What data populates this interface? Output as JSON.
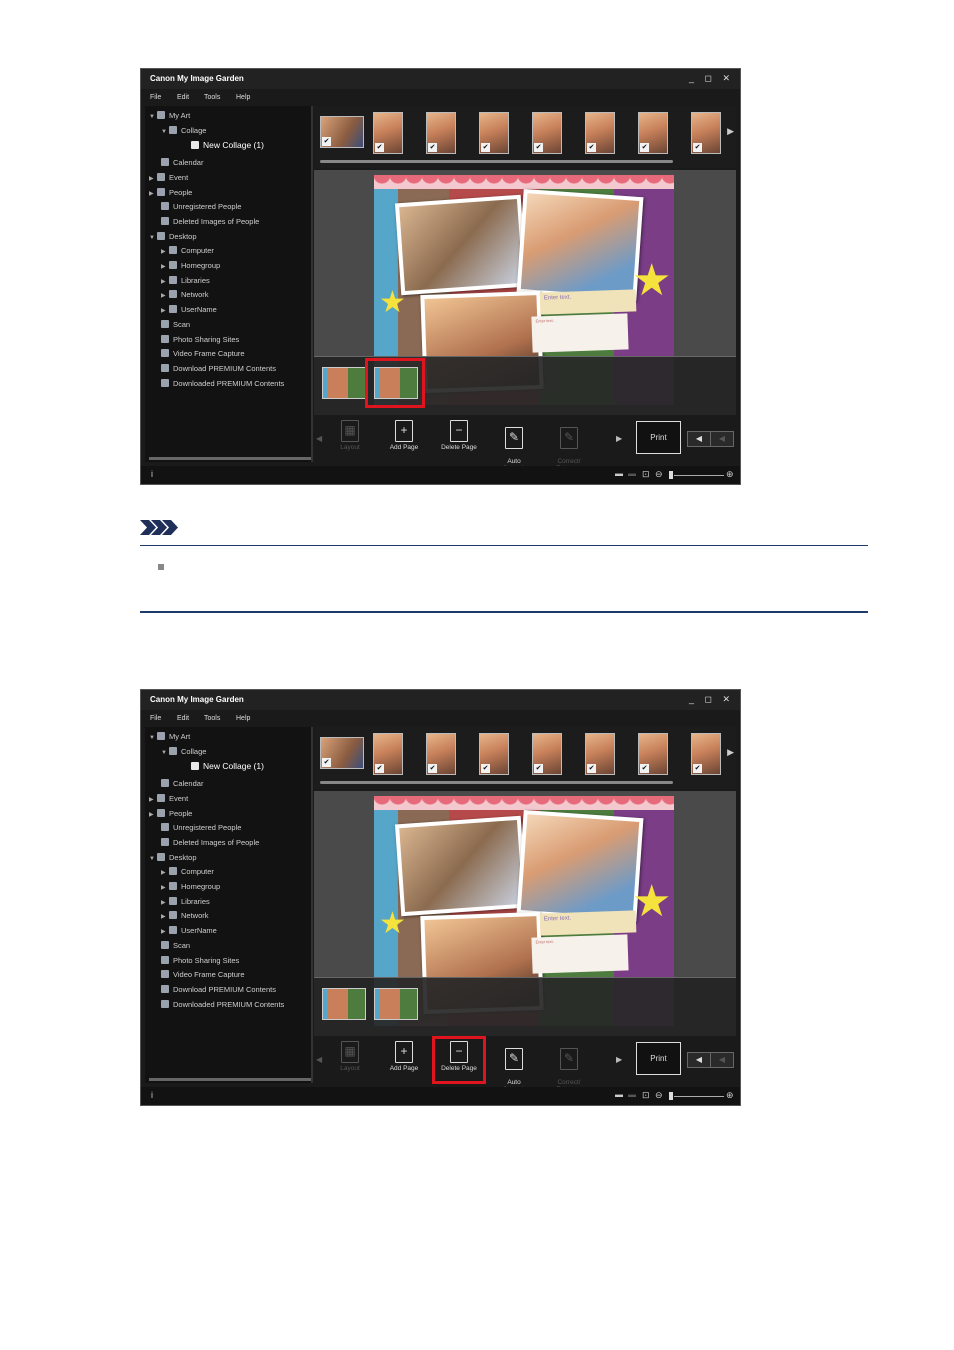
{
  "app": {
    "window_title": "Canon My Image Garden",
    "window_controls": "_ ◻ ✕",
    "menu": [
      "File",
      "Edit",
      "Tools",
      "Help"
    ],
    "tree": [
      {
        "label": "My Art",
        "arrow": "▼"
      },
      {
        "label": "Collage",
        "arrow": "▼"
      },
      {
        "label": "New Collage (1)",
        "arrow": ""
      },
      {
        "label": "Calendar",
        "arrow": ""
      },
      {
        "label": "Event",
        "arrow": "▶"
      },
      {
        "label": "People",
        "arrow": "▶"
      },
      {
        "label": "Unregistered People",
        "arrow": ""
      },
      {
        "label": "Deleted Images of People",
        "arrow": ""
      },
      {
        "label": "Desktop",
        "arrow": "▼"
      },
      {
        "label": "Computer",
        "arrow": "▶"
      },
      {
        "label": "Homegroup",
        "arrow": "▶"
      },
      {
        "label": "Libraries",
        "arrow": "▶"
      },
      {
        "label": "Network",
        "arrow": "▶"
      },
      {
        "label": "UserName",
        "arrow": "▶"
      },
      {
        "label": "Scan",
        "arrow": ""
      },
      {
        "label": "Photo Sharing Sites",
        "arrow": ""
      },
      {
        "label": "Video Frame Capture",
        "arrow": ""
      },
      {
        "label": "Download PREMIUM Contents",
        "arrow": ""
      },
      {
        "label": "Downloaded PREMIUM Contents",
        "arrow": ""
      }
    ],
    "collage_text": {
      "enter_text": "Enter text.",
      "small_text": "Enter text."
    },
    "toolbar": {
      "layout": "Layout",
      "add_page": "Add Page",
      "delete_page": "Delete Page",
      "auto_layout": "Auto\nLayout",
      "correct_enhance": "Correct/\nEnhance",
      "print": "Print"
    },
    "status": {
      "info": "i",
      "zoom_out": "⊖",
      "zoom_in": "⊕"
    }
  },
  "colors": {
    "highlight": "#e0141e",
    "note_rule": "#1f3a6a",
    "note_chevron": "#1f2f5a"
  }
}
